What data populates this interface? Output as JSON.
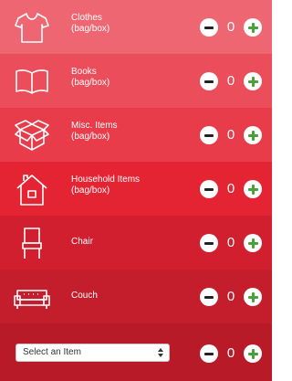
{
  "items": [
    {
      "icon": "tshirt-icon",
      "name": "Clothes",
      "unit": "(bag/box)",
      "count": "0",
      "color": "#ef6673"
    },
    {
      "icon": "book-icon",
      "name": "Books",
      "unit": "(bag/box)",
      "count": "0",
      "color": "#ec4d5a"
    },
    {
      "icon": "box-icon",
      "name": "Misc. Items",
      "unit": "(bag/box)",
      "count": "0",
      "color": "#e83c4a"
    },
    {
      "icon": "house-icon",
      "name": "Household Items",
      "unit": "(bag/box)",
      "count": "0",
      "color": "#e42433"
    },
    {
      "icon": "chair-icon",
      "name": "Chair",
      "unit": "",
      "count": "0",
      "color": "#d21f2f"
    },
    {
      "icon": "couch-icon",
      "name": "Couch",
      "unit": "",
      "count": "0",
      "color": "#c41d2b"
    }
  ],
  "custom": {
    "select_value": "Select an Item",
    "count": "0",
    "color": "#b81b27"
  }
}
